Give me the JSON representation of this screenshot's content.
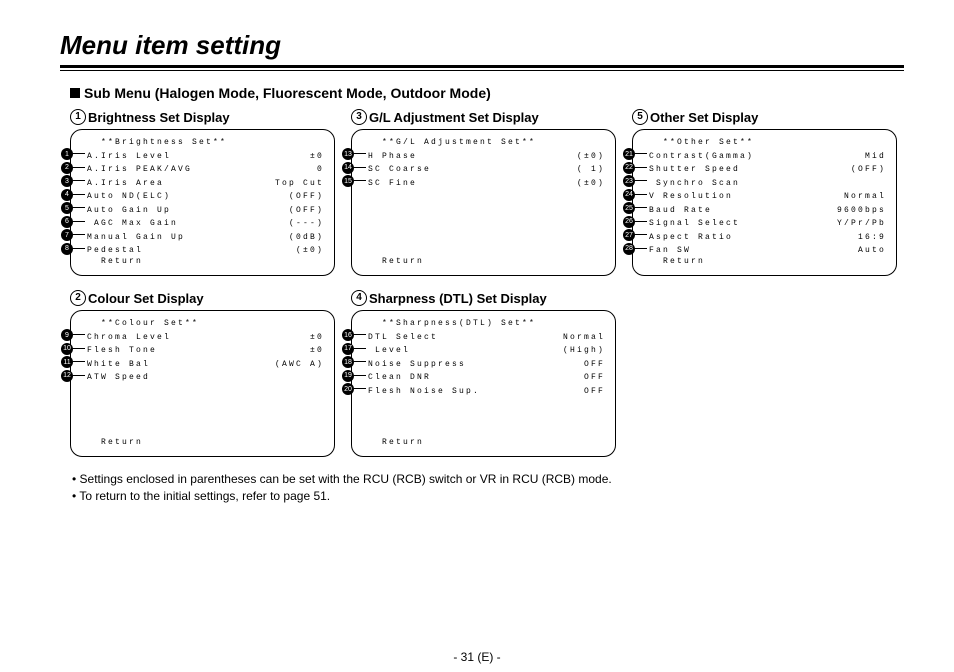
{
  "title": "Menu item setting",
  "subheader": "Sub Menu (Halogen Mode, Fluorescent Mode, Outdoor Mode)",
  "page_number": "- 31 (E) -",
  "notes": [
    "• Settings enclosed in parentheses can be set with the RCU (RCB) switch or VR in RCU (RCB) mode.",
    "• To return to the initial settings, refer to page 51."
  ],
  "return_label": "Return",
  "blocks": [
    {
      "num": "1",
      "title": "Brightness Set Display",
      "osd_title": "**Brightness Set**",
      "badge_start": 1,
      "rows": [
        {
          "label": "A.Iris Level",
          "value": "±0"
        },
        {
          "label": "A.Iris PEAK/AVG",
          "value": "0"
        },
        {
          "label": "A.Iris Area",
          "value": "Top Cut"
        },
        {
          "label": "Auto ND(ELC)",
          "value": "(OFF)"
        },
        {
          "label": "Auto Gain Up",
          "value": "(OFF)"
        },
        {
          "label": " AGC Max Gain",
          "value": "(---)"
        },
        {
          "label": "Manual Gain Up",
          "value": "(0dB)"
        },
        {
          "label": "Pedestal",
          "value": "(±0)"
        }
      ]
    },
    {
      "num": "3",
      "title": "G/L Adjustment Set Display",
      "osd_title": "**G/L Adjustment Set**",
      "badge_start": 13,
      "rows": [
        {
          "label": "H Phase",
          "value": "(±0)"
        },
        {
          "label": "SC Coarse",
          "value": "( 1)"
        },
        {
          "label": "SC Fine",
          "value": "(±0)"
        }
      ]
    },
    {
      "num": "5",
      "title": "Other Set Display",
      "osd_title": "**Other Set**",
      "badge_start": 21,
      "rows": [
        {
          "label": "Contrast(Gamma)",
          "value": "Mid"
        },
        {
          "label": "Shutter Speed",
          "value": "(OFF)"
        },
        {
          "label": " Synchro Scan",
          "value": ""
        },
        {
          "label": "V Resolution",
          "value": "Normal"
        },
        {
          "label": "Baud Rate",
          "value": "9600bps"
        },
        {
          "label": "Signal Select",
          "value": "Y/Pr/Pb"
        },
        {
          "label": "Aspect Ratio",
          "value": "16:9"
        },
        {
          "label": "Fan SW",
          "value": "Auto"
        }
      ]
    },
    {
      "num": "2",
      "title": "Colour Set Display",
      "osd_title": "**Colour Set**",
      "badge_start": 9,
      "rows": [
        {
          "label": "Chroma Level",
          "value": "±0"
        },
        {
          "label": "Flesh Tone",
          "value": "±0"
        },
        {
          "label": "White Bal",
          "value": "(AWC A)"
        },
        {
          "label": "ATW Speed",
          "value": ""
        }
      ]
    },
    {
      "num": "4",
      "title": "Sharpness (DTL) Set Display",
      "osd_title": "**Sharpness(DTL) Set**",
      "badge_start": 16,
      "rows": [
        {
          "label": "DTL Select",
          "value": "Normal"
        },
        {
          "label": " Level",
          "value": "(High)"
        },
        {
          "label": "Noise Suppress",
          "value": "OFF"
        },
        {
          "label": "Clean DNR",
          "value": "OFF"
        },
        {
          "label": "Flesh Noise Sup.",
          "value": "OFF"
        }
      ]
    }
  ]
}
